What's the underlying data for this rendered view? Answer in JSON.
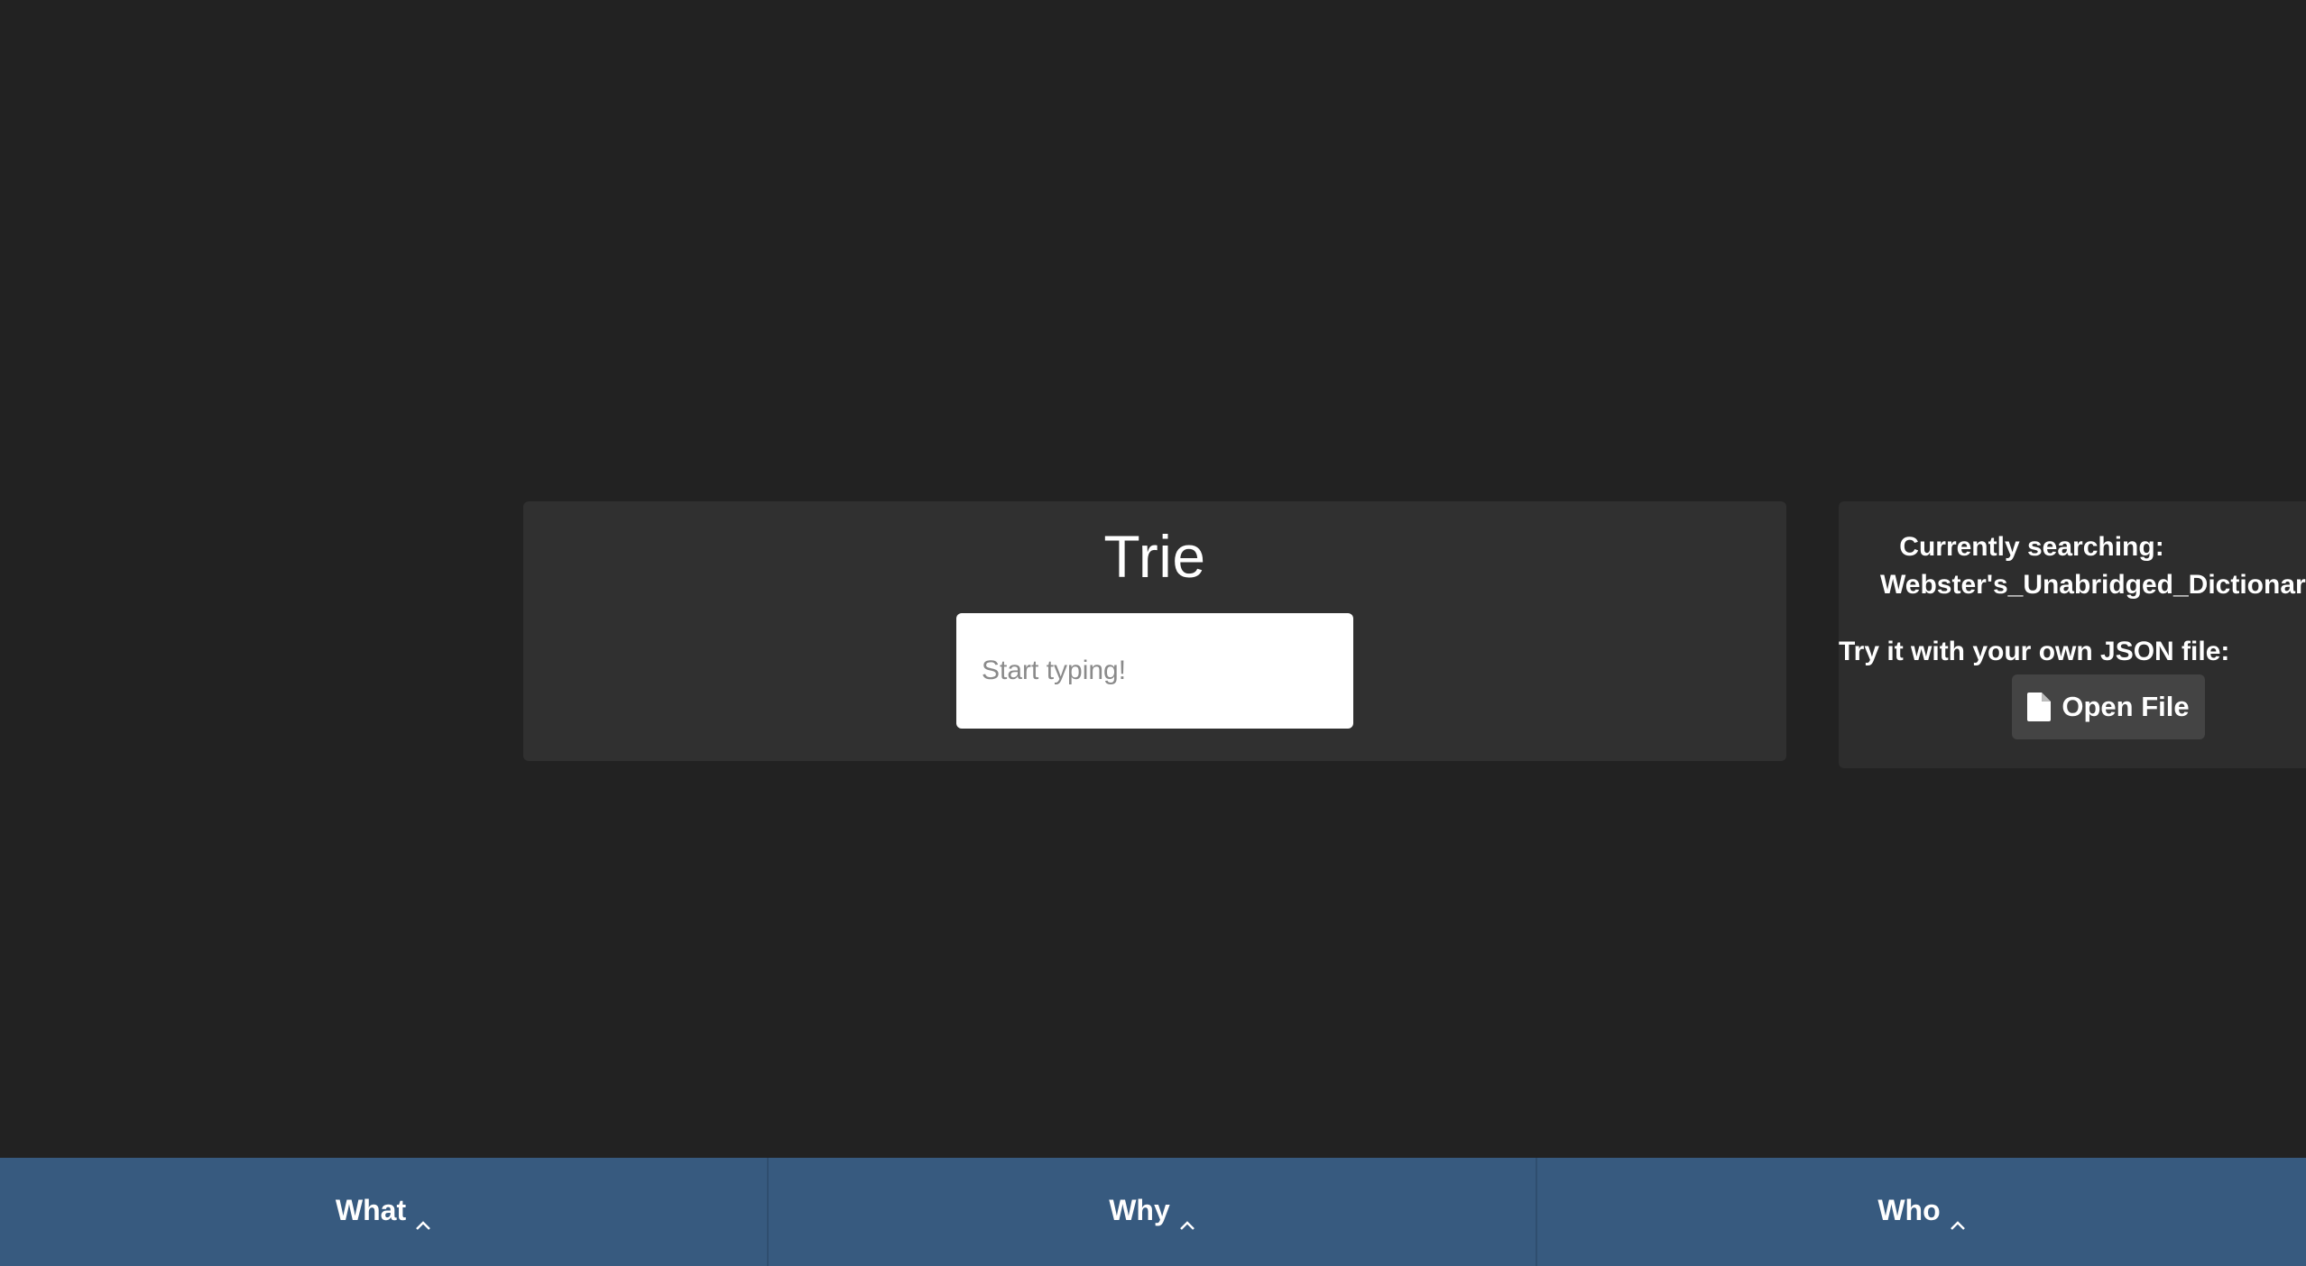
{
  "main": {
    "title": "Trie",
    "search": {
      "placeholder": "Start typing!",
      "value": ""
    }
  },
  "side_panel": {
    "currently_label": "Currently searching:",
    "current_file": "Webster's_Unabridged_Dictionary.json",
    "try_label": "Try it with your own JSON file:",
    "open_button": {
      "label": "Open File",
      "icon": "file-icon"
    }
  },
  "bottom_nav": {
    "tabs": [
      {
        "label": "What",
        "icon": "chevron-up-icon"
      },
      {
        "label": "Why",
        "icon": "chevron-up-icon"
      },
      {
        "label": "Who",
        "icon": "chevron-up-icon"
      }
    ]
  },
  "colors": {
    "background": "#222222",
    "card": "#303030",
    "bottom_bar": "#375a7f",
    "button": "#444444"
  }
}
